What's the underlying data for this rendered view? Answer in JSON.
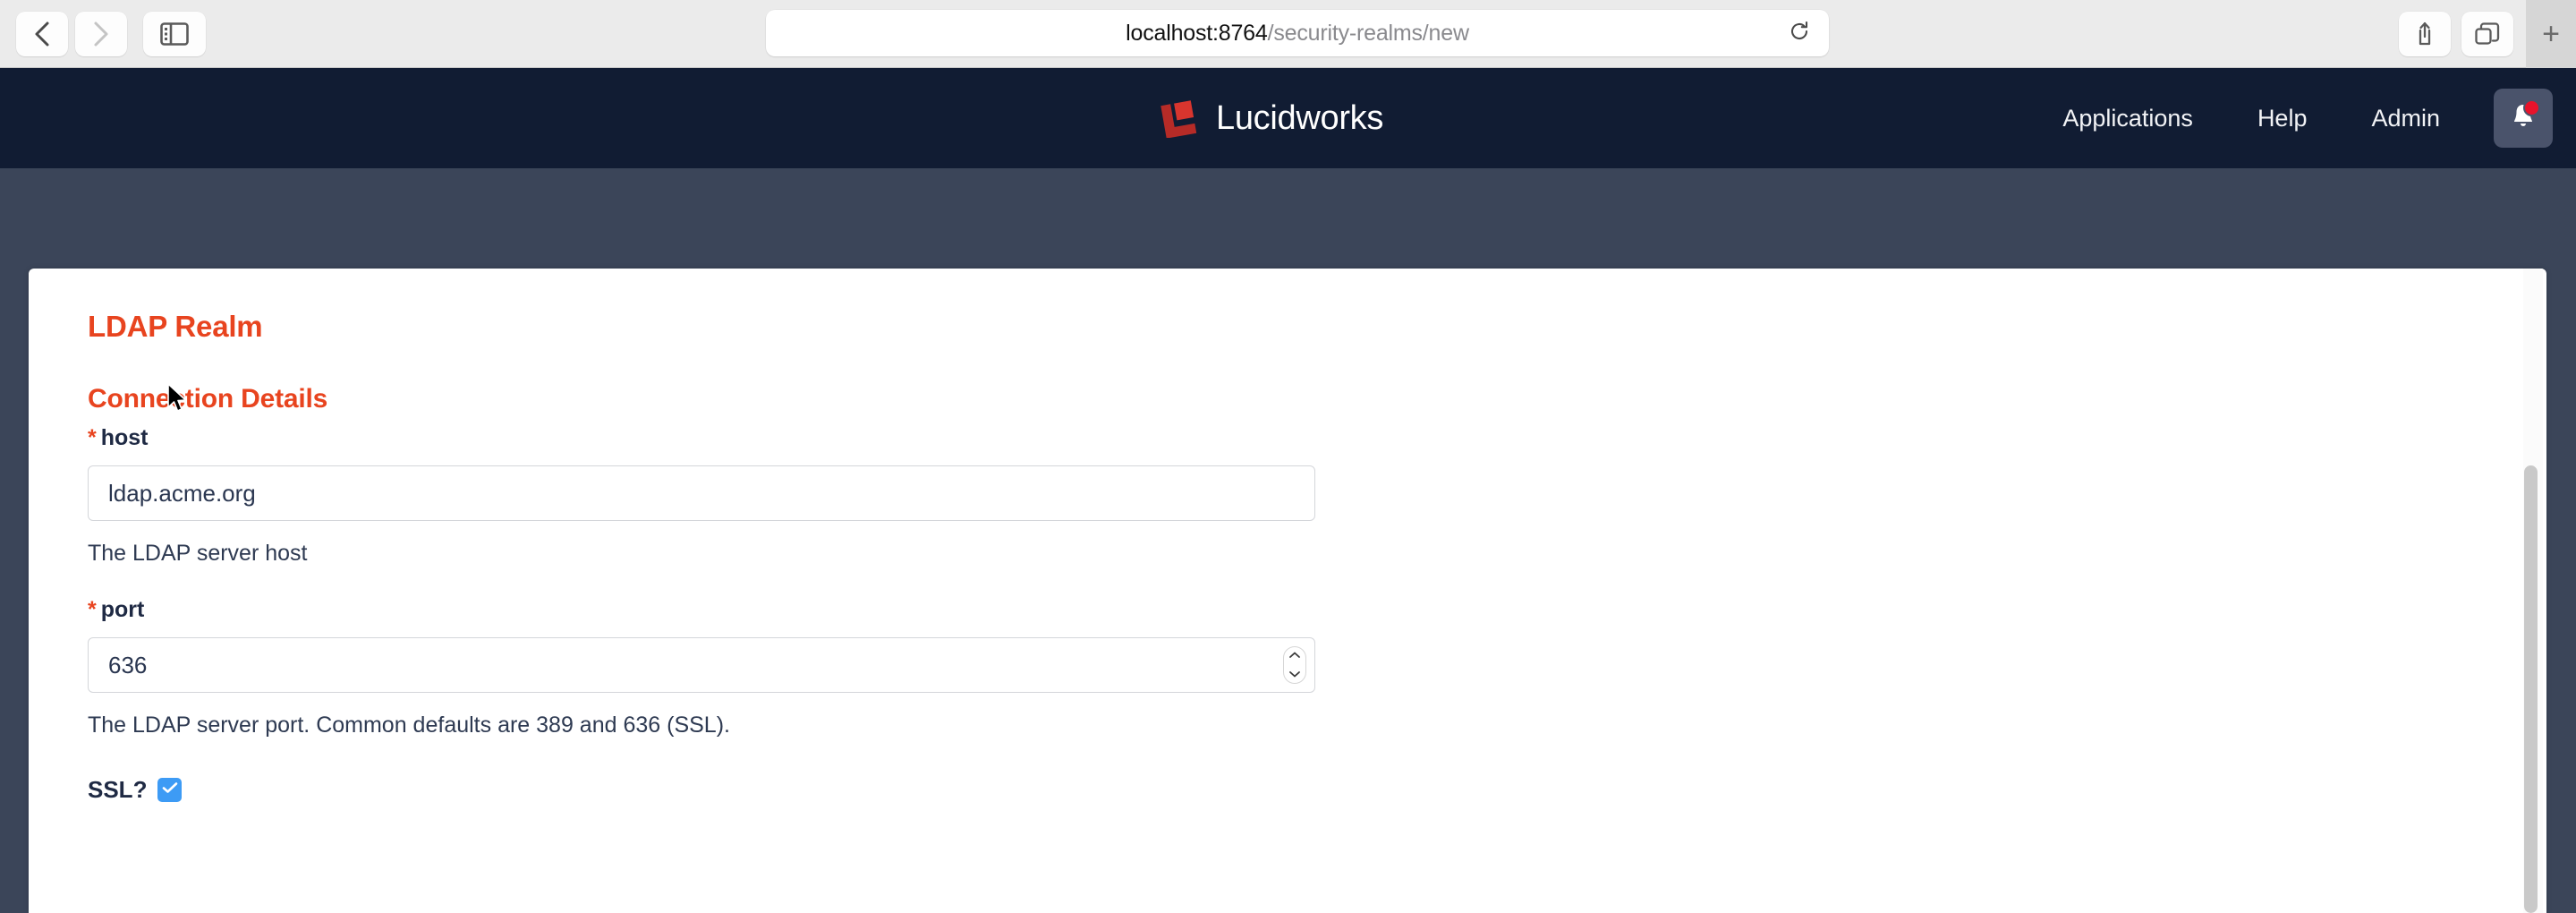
{
  "browser": {
    "back_icon": "chevron-left-icon",
    "forward_icon": "chevron-right-icon",
    "sidebar_icon": "sidebar-toggle-icon",
    "url_domain": "localhost:8764",
    "url_path": "/security-realms/new",
    "url_full": "localhost:8764/security-realms/new",
    "reload_icon": "reload-icon",
    "share_icon": "share-icon",
    "tabs_icon": "tab-overview-icon",
    "newtab_label": "+"
  },
  "header": {
    "brand_name": "Lucidworks",
    "brand_logo_color": "#c0392b",
    "background": "#111c33",
    "nav": [
      {
        "label": "Applications"
      },
      {
        "label": "Help"
      },
      {
        "label": "Admin"
      }
    ],
    "bell_icon": "notification-bell-icon",
    "bell_badge_color": "#e8132b"
  },
  "page": {
    "background": "#3b4559",
    "accent_color": "#e8441f"
  },
  "form": {
    "title": "LDAP Realm",
    "section_heading": "Connection Details",
    "required_marker": "*",
    "fields": [
      {
        "label": "host",
        "required": true,
        "value": "ldap.acme.org",
        "placeholder": "",
        "helper": "The LDAP server host",
        "type": "text"
      },
      {
        "label": "port",
        "required": true,
        "value": "636",
        "placeholder": "",
        "helper": "The LDAP server port. Common defaults are 389 and 636 (SSL).",
        "type": "number"
      }
    ],
    "checkbox": {
      "label": "SSL?",
      "checked": true,
      "color": "#3d9bf5"
    }
  }
}
